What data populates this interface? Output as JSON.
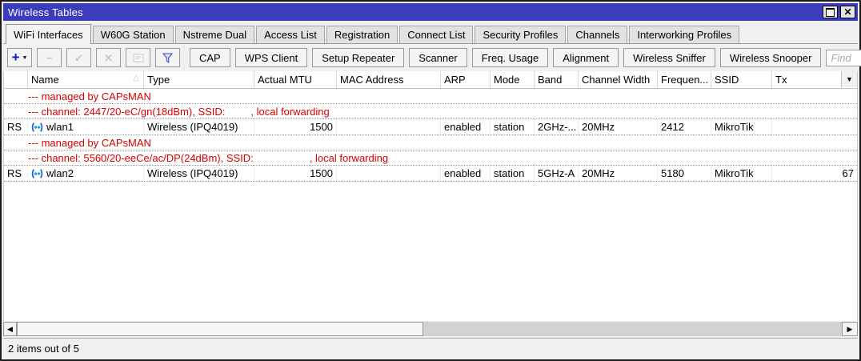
{
  "window": {
    "title": "Wireless Tables",
    "close_glyph": "✕"
  },
  "tabs": [
    {
      "label": "WiFi Interfaces",
      "active": true
    },
    {
      "label": "W60G Station"
    },
    {
      "label": "Nstreme Dual"
    },
    {
      "label": "Access List"
    },
    {
      "label": "Registration"
    },
    {
      "label": "Connect List"
    },
    {
      "label": "Security Profiles"
    },
    {
      "label": "Channels"
    },
    {
      "label": "Interworking Profiles"
    }
  ],
  "toolbar": {
    "icon_glyphs": {
      "add": "+",
      "caret": "▼",
      "remove": "−",
      "enable": "✓",
      "disable": "✕"
    },
    "icons": [
      "plus-icon",
      "dropdown-caret-icon",
      "minus-icon",
      "check-icon",
      "x-icon",
      "comment-icon",
      "filter-funnel-icon"
    ],
    "buttons": [
      "CAP",
      "WPS Client",
      "Setup Repeater",
      "Scanner",
      "Freq. Usage",
      "Alignment",
      "Wireless Sniffer",
      "Wireless Snooper"
    ],
    "find_placeholder": "Find"
  },
  "table": {
    "sort_glyph": "△",
    "menu_glyph": "▼",
    "columns": [
      {
        "label": ""
      },
      {
        "label": "Name",
        "sort": true
      },
      {
        "label": "Type"
      },
      {
        "label": "Actual MTU"
      },
      {
        "label": "MAC Address"
      },
      {
        "label": "ARP"
      },
      {
        "label": "Mode"
      },
      {
        "label": "Band"
      },
      {
        "label": "Channel Width"
      },
      {
        "label": "Frequen..."
      },
      {
        "label": "SSID"
      },
      {
        "label": "Tx"
      }
    ],
    "rows": [
      {
        "type": "note",
        "text": "--- managed by CAPsMAN"
      },
      {
        "type": "note",
        "text": "--- channel: 2447/20-eC/gn(18dBm), SSID:",
        "text2": ", local forwarding",
        "gap": 32
      },
      {
        "type": "data",
        "cells": [
          "RS",
          "wlan1",
          "Wireless (IPQ4019)",
          "1500",
          "",
          "enabled",
          "station",
          "2GHz-...",
          "20MHz",
          "2412",
          "MikroTik",
          ""
        ]
      },
      {
        "type": "note",
        "text": "--- managed by CAPsMAN"
      },
      {
        "type": "note",
        "text": "--- channel: 5560/20-eeCe/ac/DP(24dBm), SSID:",
        "text2": ", local forwarding",
        "gap": 70
      },
      {
        "type": "data",
        "cells": [
          "RS",
          "wlan2",
          "Wireless (IPQ4019)",
          "1500",
          "",
          "enabled",
          "station",
          "5GHz-A",
          "20MHz",
          "5180",
          "MikroTik",
          "67"
        ]
      }
    ]
  },
  "scrollbar": {
    "left_glyph": "◀",
    "right_glyph": "▶"
  },
  "status_bar": {
    "text": "2 items out of 5"
  }
}
